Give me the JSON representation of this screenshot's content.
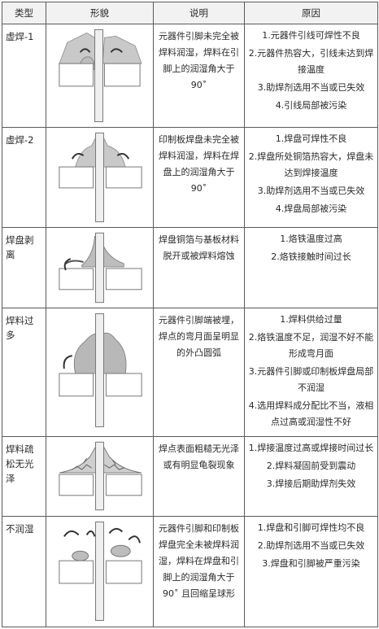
{
  "headers": {
    "type": "类型",
    "shape": "形貌",
    "desc": "说明",
    "cause": "原因"
  },
  "rows": [
    {
      "type": "虚焊-1",
      "desc": "元器件引脚未完全被焊料润湿，焊料在引脚上的润湿角大于 90˚",
      "causes": [
        "1.元器件引线可焊性不良",
        "2.元器件热容大，引线未达到焊接温度",
        "3.助焊剂选用不当或已失效",
        "4.引线局部被污染"
      ]
    },
    {
      "type": "虚焊-2",
      "desc": "印制板焊盘未完全被焊料润湿，焊料在焊盘上的润湿角大于 90˚",
      "causes": [
        "1.焊盘可焊性不良",
        "2.焊盘所处铜箔热容大，焊盘未达到焊接温度",
        "3.助焊剂选用不当或已失效",
        "4.焊盘局部被污染"
      ]
    },
    {
      "type": "焊盘剥离",
      "desc": "焊盘铜箔与基板材料脱开或被焊料熔蚀",
      "causes": [
        "1.烙铁温度过高",
        "2.烙铁接触时间过长"
      ]
    },
    {
      "type": "焊料过多",
      "desc": "元器件引脚端被埋，焊点的弯月面呈明显的外凸圆弧",
      "causes": [
        "1.焊料供给过量",
        "2.烙铁温度不足，润湿不好不能形成弯月面",
        "3.元器件引脚或印制板焊盘局部不润湿",
        "4.选用焊料成分配比不当，液相点过高或润湿性不好"
      ]
    },
    {
      "type": "焊料疏松无光泽",
      "desc": "焊点表面粗糙无光泽或有明显龟裂现象",
      "causes": [
        "1.焊接温度过高或焊接时间过长",
        "2.焊料凝固前受到震动",
        "3.焊接后期助焊剂失效"
      ]
    },
    {
      "type": "不润湿",
      "desc": "元器件引脚和印制板焊盘完全未被焊料润湿，焊料在焊盘和引脚上的润湿角大于 90˚ 且回缩呈球形",
      "causes": [
        "1.焊盘和引脚可焊性均不良",
        "2.助焊剂选用不当或已失效",
        "3.焊盘和引脚被严重污染"
      ]
    }
  ]
}
